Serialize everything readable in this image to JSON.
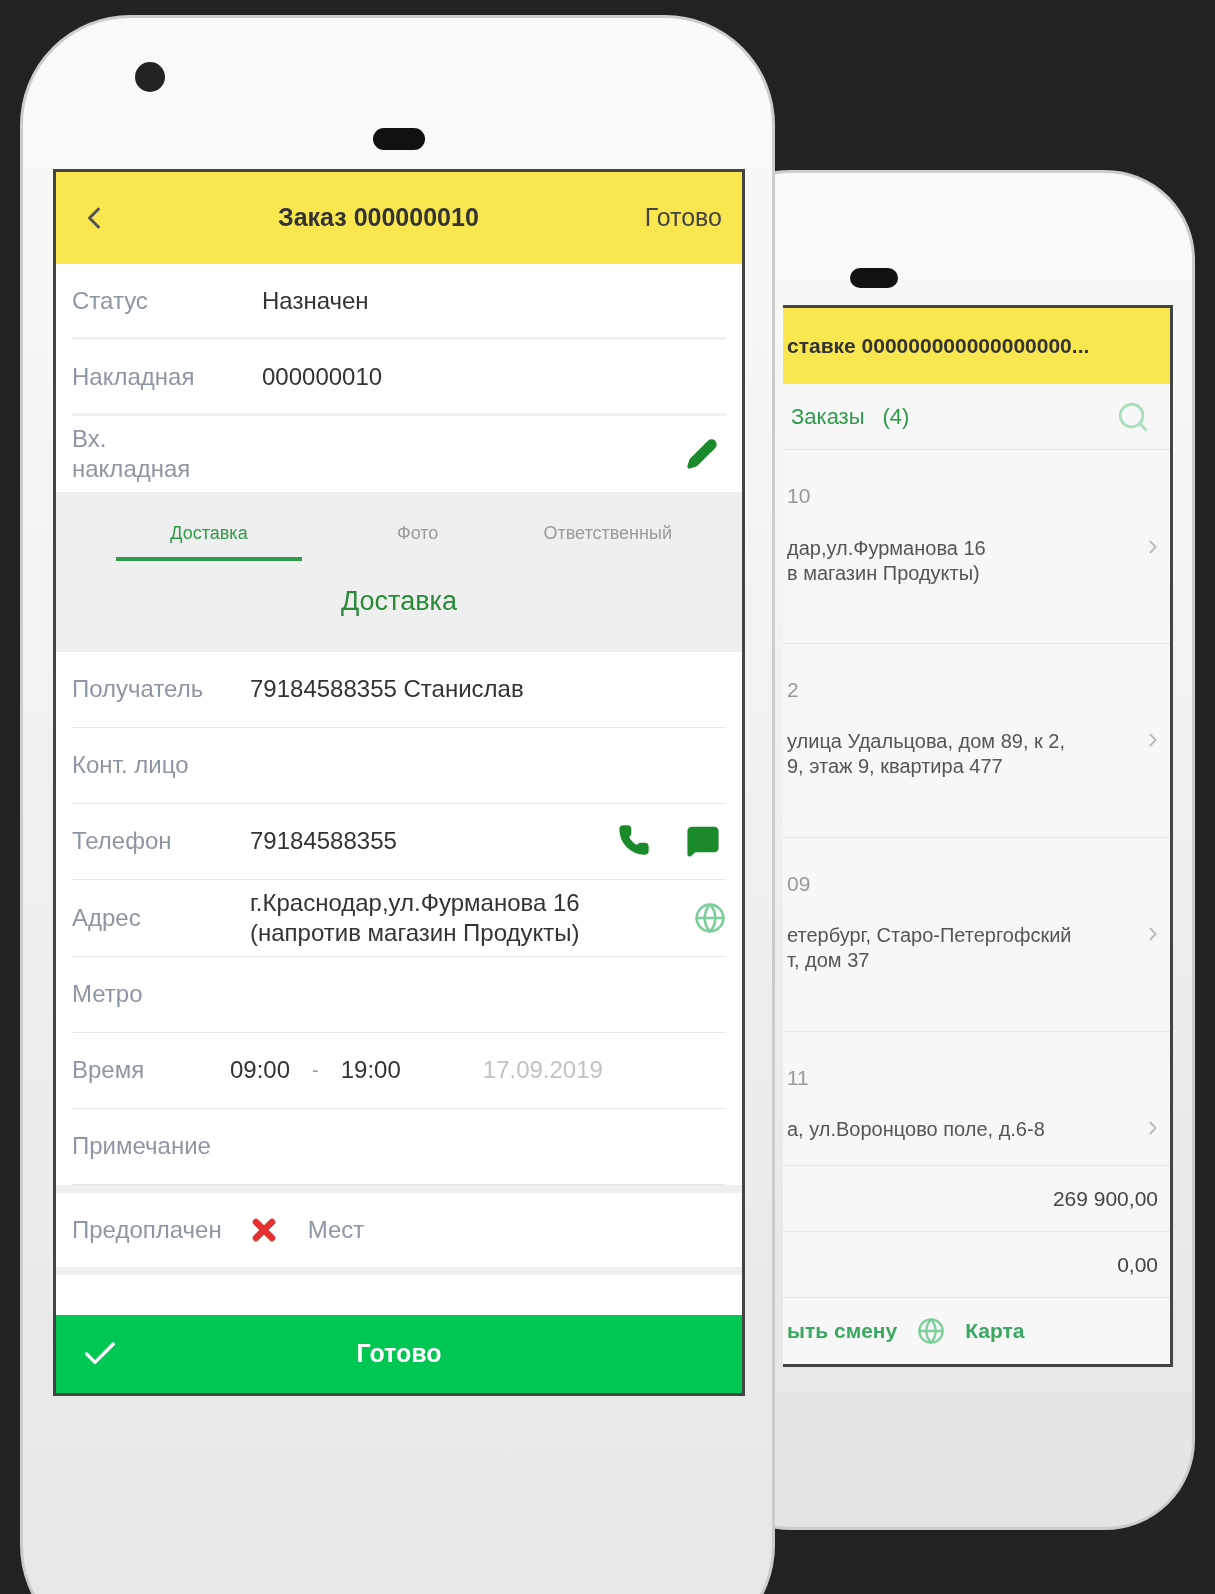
{
  "order_screen": {
    "title": "Заказ 000000010",
    "action": "Готово",
    "top_fields": [
      {
        "kind": "text",
        "label": "Статус",
        "value": "Назначен"
      },
      {
        "kind": "text",
        "label": "Накладная",
        "value": "000000010"
      },
      {
        "kind": "edit",
        "label": "Вх.\nнакладная"
      }
    ],
    "tabs": [
      {
        "label": "Доставка",
        "selected": true
      },
      {
        "label": "Фото",
        "selected": false
      },
      {
        "label": "Ответственный",
        "selected": false
      }
    ],
    "section_title": "Доставка",
    "fields": [
      {
        "kind": "text",
        "label": "Получатель",
        "value": "79184588355 Станислав"
      },
      {
        "kind": "text",
        "label": "Конт. лицо"
      },
      {
        "kind": "phone",
        "label": "Телефон",
        "value": "79184588355"
      },
      {
        "kind": "address",
        "label": "Адрес",
        "value": "г.Краснодар,ул.Фурманова 16\n(напротив магазин Продукты)"
      },
      {
        "kind": "text",
        "label": "Метро"
      },
      {
        "kind": "time",
        "label": "Время",
        "from": "09:00",
        "separator": "-",
        "to": "19:00",
        "date": "17.09.2019"
      },
      {
        "kind": "text",
        "label": "Примечание"
      }
    ],
    "prepaid": {
      "label": "Предоплачен",
      "checked": false,
      "places_label": "Мест"
    },
    "done_button": "Готово"
  },
  "list_screen": {
    "title": "ставке 000000000000000000...",
    "tab": "Заказы",
    "count": "(4)",
    "orders": [
      {
        "number": "10",
        "address": "дар,ул.Фурманова 16\nв магазин Продукты)"
      },
      {
        "number": "2",
        "address": "улица Удальцова, дом 89, к 2,\n9, этаж 9, квартира 477"
      },
      {
        "number": "09",
        "address": "етербург, Старо-Петергофский\nт, дом 37"
      },
      {
        "number": "11",
        "address": "а, ул.Воронцово поле, д.6-8"
      }
    ],
    "totals": [
      "269 900,00",
      "0,00"
    ],
    "footer": {
      "shift": "ыть смену",
      "map": "Карта"
    }
  }
}
